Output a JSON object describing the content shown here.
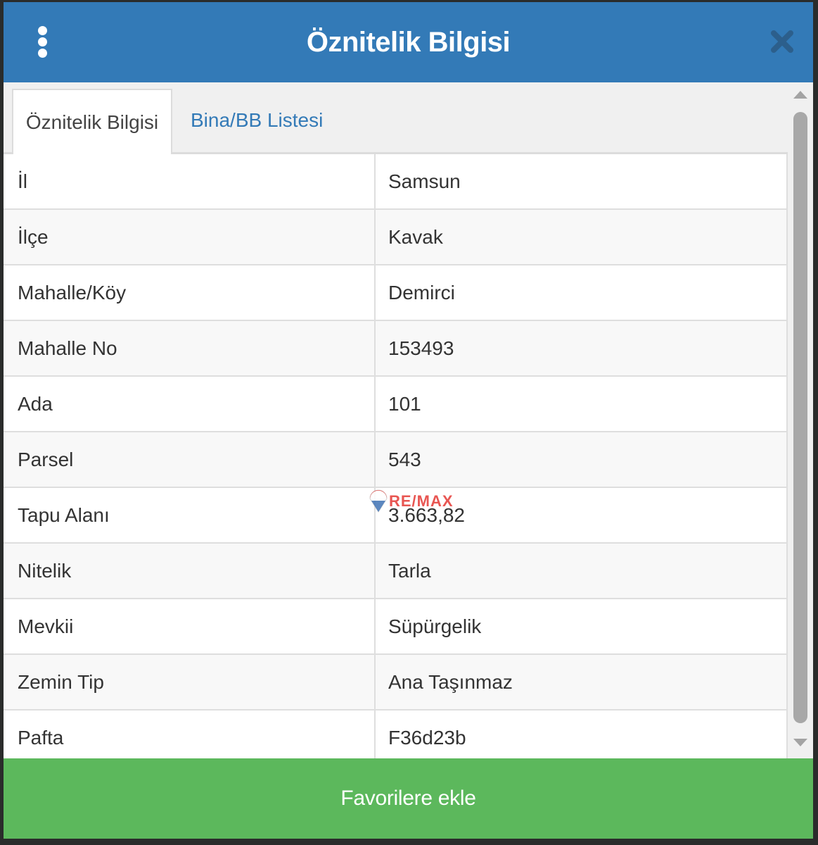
{
  "header": {
    "title": "Öznitelik Bilgisi"
  },
  "icons": {
    "menu": "kebab-menu-icon",
    "close": "close-icon",
    "watermark": "remax-balloon-logo"
  },
  "tabs": [
    {
      "label": "Öznitelik Bilgisi",
      "active": true
    },
    {
      "label": "Bina/BB Listesi",
      "active": false
    }
  ],
  "attributes": [
    {
      "key": "İl",
      "value": "Samsun"
    },
    {
      "key": "İlçe",
      "value": "Kavak"
    },
    {
      "key": "Mahalle/Köy",
      "value": "Demirci"
    },
    {
      "key": "Mahalle No",
      "value": "153493"
    },
    {
      "key": "Ada",
      "value": "101"
    },
    {
      "key": "Parsel",
      "value": "543"
    },
    {
      "key": "Tapu Alanı",
      "value": "3.663,82"
    },
    {
      "key": "Nitelik",
      "value": "Tarla"
    },
    {
      "key": "Mevkii",
      "value": "Süpürgelik"
    },
    {
      "key": "Zemin Tip",
      "value": "Ana Taşınmaz"
    },
    {
      "key": "Pafta",
      "value": "F36d23b"
    }
  ],
  "watermark": {
    "text": "RE/MAX"
  },
  "footer": {
    "button_label": "Favorilere ekle"
  },
  "colors": {
    "header": "#337ab7",
    "footer": "#5cb85c",
    "link": "#337ab7"
  }
}
